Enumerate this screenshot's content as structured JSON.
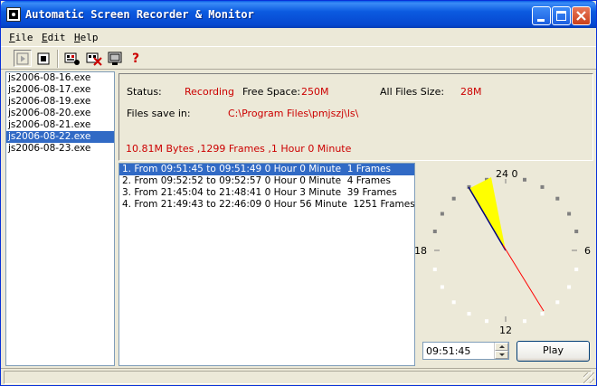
{
  "window": {
    "title": "Automatic Screen Recorder & Monitor"
  },
  "menu": [
    {
      "accel": "F",
      "rest": "ile"
    },
    {
      "accel": "E",
      "rest": "dit"
    },
    {
      "accel": "H",
      "rest": "elp"
    }
  ],
  "toolbar": {
    "icons": [
      "play-icon",
      "stop-icon",
      "record-settings-icon",
      "delete-icon",
      "monitor-icon",
      "help-icon"
    ],
    "help_glyph": "?"
  },
  "files": [
    {
      "name": "js2006-08-16.exe",
      "selected": false
    },
    {
      "name": "js2006-08-17.exe",
      "selected": false
    },
    {
      "name": "js2006-08-19.exe",
      "selected": false
    },
    {
      "name": "js2006-08-20.exe",
      "selected": false
    },
    {
      "name": "js2006-08-21.exe",
      "selected": false
    },
    {
      "name": "js2006-08-22.exe",
      "selected": true
    },
    {
      "name": "js2006-08-23.exe",
      "selected": false
    }
  ],
  "info": {
    "status_label": "Status:",
    "status_value": "Recording",
    "free_space_label": "Free Space:",
    "free_space_value": "250M",
    "all_files_label": "All Files Size:",
    "all_files_value": "28M",
    "save_in_label": "Files save in:",
    "save_in_value": "C:\\Program Files\\pmjszj\\ls\\",
    "summary": "10.81M Bytes ,1299 Frames ,1 Hour 0 Minute"
  },
  "records": [
    {
      "text": "1. From 09:51:45 to 09:51:49 0 Hour 0 Minute  1 Frames",
      "selected": true
    },
    {
      "text": "2. From 09:52:52 to 09:52:57 0 Hour 0 Minute  4 Frames",
      "selected": false
    },
    {
      "text": "3. From 21:45:04 to 21:48:41 0 Hour 3 Minute  39 Frames",
      "selected": false
    },
    {
      "text": "4. From 21:49:43 to 22:46:09 0 Hour 56 Minute  1251 Frames",
      "selected": false
    }
  ],
  "clock": {
    "top_label": "24 0",
    "right_label": "6",
    "bottom_label": "12",
    "left_label": "18",
    "hour_hand_color": "#000080",
    "minute_hand_color": "#ff0000",
    "sector_color": "#ffff00",
    "dot_dark": "#808080",
    "dot_light": "#ffffff"
  },
  "controls": {
    "time_value": "09:51:45",
    "play_label": "Play"
  },
  "colors": {
    "value_red": "#cc0000",
    "selection_blue": "#316ac5"
  }
}
